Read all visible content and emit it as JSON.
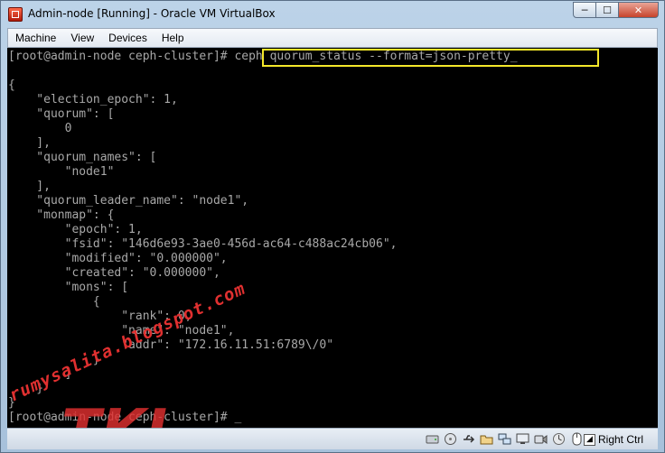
{
  "window": {
    "title": "Admin-node [Running] - Oracle VM VirtualBox",
    "minimize_glyph": "─",
    "maximize_glyph": "☐",
    "close_glyph": "✕"
  },
  "menubar": {
    "items": [
      "Machine",
      "View",
      "Devices",
      "Help"
    ]
  },
  "terminal": {
    "lines": [
      "[root@admin-node ceph-cluster]# ceph quorum_status --format=json-pretty_",
      "",
      "{",
      "    \"election_epoch\": 1,",
      "    \"quorum\": [",
      "        0",
      "    ],",
      "    \"quorum_names\": [",
      "        \"node1\"",
      "    ],",
      "    \"quorum_leader_name\": \"node1\",",
      "    \"monmap\": {",
      "        \"epoch\": 1,",
      "        \"fsid\": \"146d6e93-3ae0-456d-ac64-c488ac24cb06\",",
      "        \"modified\": \"0.000000\",",
      "        \"created\": \"0.000000\",",
      "        \"mons\": [",
      "            {",
      "                \"rank\": 0,",
      "                \"name\": \"node1\",",
      "                \"addr\": \"172.16.11.51:6789\\/0\"",
      "            }",
      "        ]",
      "    }",
      "}",
      "[root@admin-node ceph-cluster]# _"
    ],
    "highlight_color": "#f4e72a",
    "text_color": "#a8a8a8"
  },
  "watermark": {
    "blog_text": "rumysalita.blogspot.com",
    "logo_text": "TKJ",
    "color": "#e03030"
  },
  "statusbar": {
    "icons": [
      "hard-disk-icon",
      "optical-drive-icon",
      "usb-icon",
      "shared-folders-icon",
      "network-icon",
      "display-icon",
      "video-capture-icon",
      "cpu-icon",
      "mouse-integration-icon",
      "host-key-arrow-icon"
    ],
    "host_key_label": "Right Ctrl"
  }
}
